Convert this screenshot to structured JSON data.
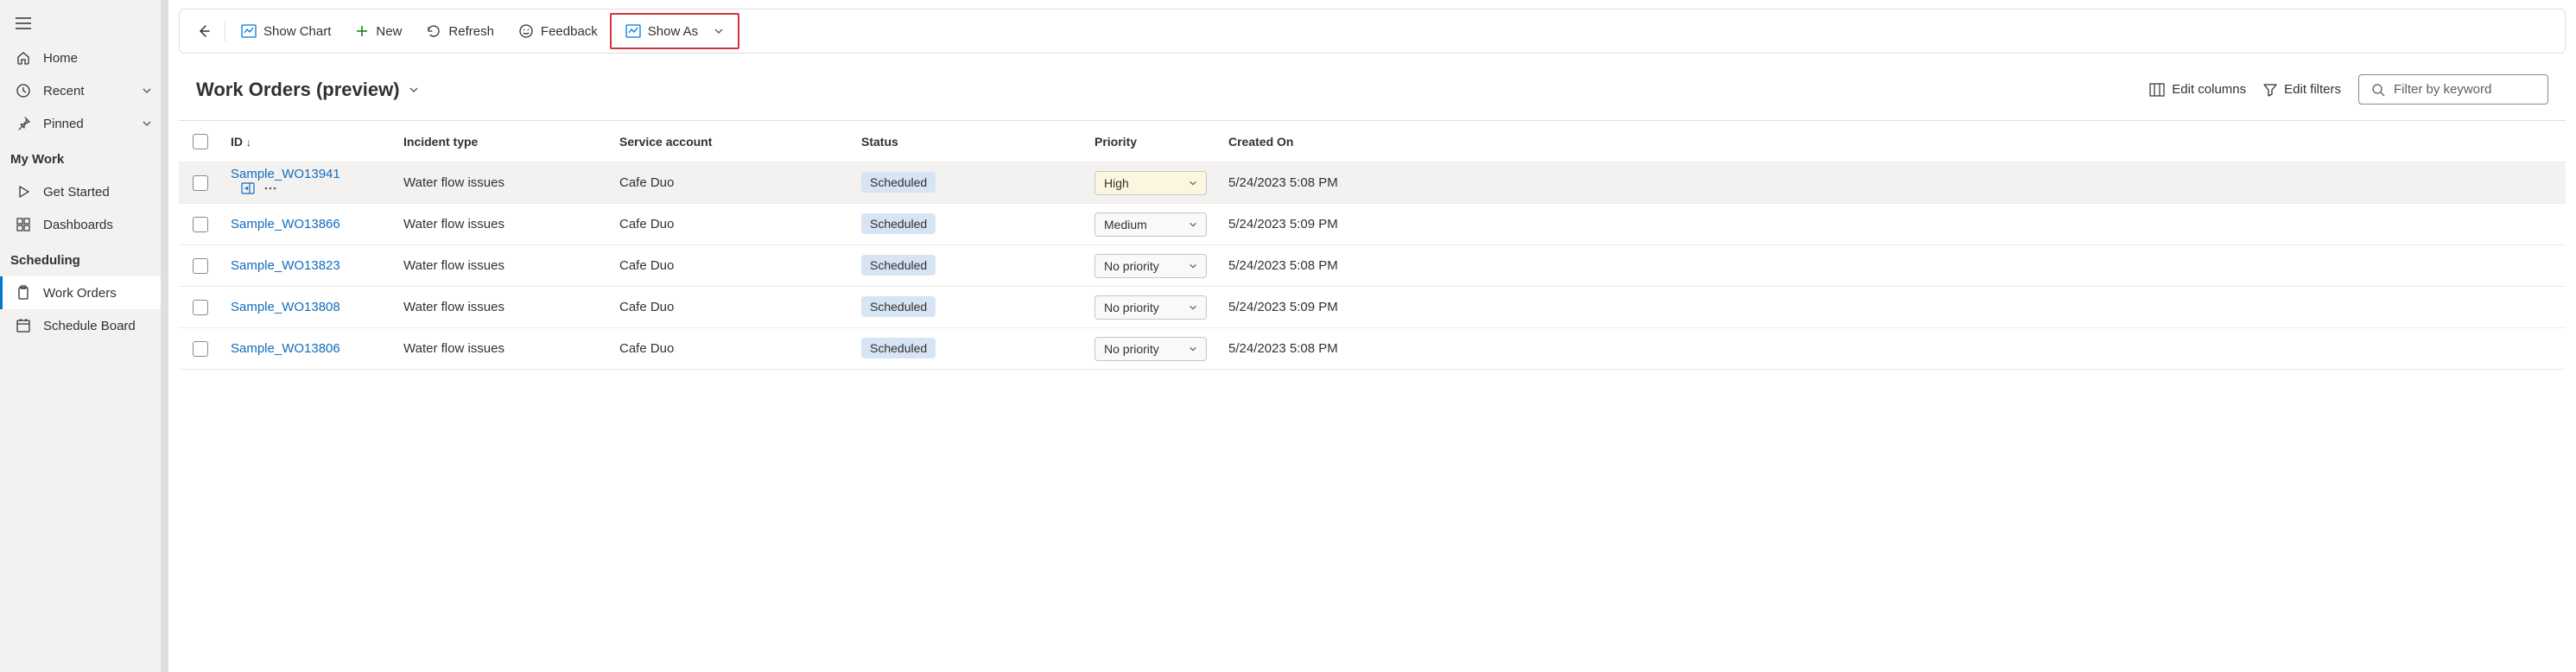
{
  "sidebar": {
    "top_items": [
      {
        "icon": "home",
        "label": "Home"
      },
      {
        "icon": "clock",
        "label": "Recent",
        "chevron": true
      },
      {
        "icon": "pin",
        "label": "Pinned",
        "chevron": true
      }
    ],
    "sections": [
      {
        "title": "My Work",
        "items": [
          {
            "icon": "play",
            "label": "Get Started"
          },
          {
            "icon": "dashboard",
            "label": "Dashboards"
          }
        ]
      },
      {
        "title": "Scheduling",
        "items": [
          {
            "icon": "clipboard",
            "label": "Work Orders",
            "active": true
          },
          {
            "icon": "calendar",
            "label": "Schedule Board"
          }
        ]
      }
    ]
  },
  "commandbar": {
    "show_chart": "Show Chart",
    "new": "New",
    "refresh": "Refresh",
    "feedback": "Feedback",
    "show_as": "Show As"
  },
  "view": {
    "title": "Work Orders (preview)",
    "edit_columns": "Edit columns",
    "edit_filters": "Edit filters",
    "filter_placeholder": "Filter by keyword"
  },
  "table": {
    "headers": {
      "id": "ID",
      "incident": "Incident type",
      "service": "Service account",
      "status": "Status",
      "priority": "Priority",
      "created": "Created On"
    },
    "rows": [
      {
        "id": "Sample_WO13941",
        "incident": "Water flow issues",
        "service": "Cafe Duo",
        "status": "Scheduled",
        "priority": "High",
        "created": "5/24/2023 5:08 PM",
        "hovered": true
      },
      {
        "id": "Sample_WO13866",
        "incident": "Water flow issues",
        "service": "Cafe Duo",
        "status": "Scheduled",
        "priority": "Medium",
        "created": "5/24/2023 5:09 PM"
      },
      {
        "id": "Sample_WO13823",
        "incident": "Water flow issues",
        "service": "Cafe Duo",
        "status": "Scheduled",
        "priority": "No priority",
        "created": "5/24/2023 5:08 PM"
      },
      {
        "id": "Sample_WO13808",
        "incident": "Water flow issues",
        "service": "Cafe Duo",
        "status": "Scheduled",
        "priority": "No priority",
        "created": "5/24/2023 5:09 PM"
      },
      {
        "id": "Sample_WO13806",
        "incident": "Water flow issues",
        "service": "Cafe Duo",
        "status": "Scheduled",
        "priority": "No priority",
        "created": "5/24/2023 5:08 PM"
      }
    ]
  }
}
